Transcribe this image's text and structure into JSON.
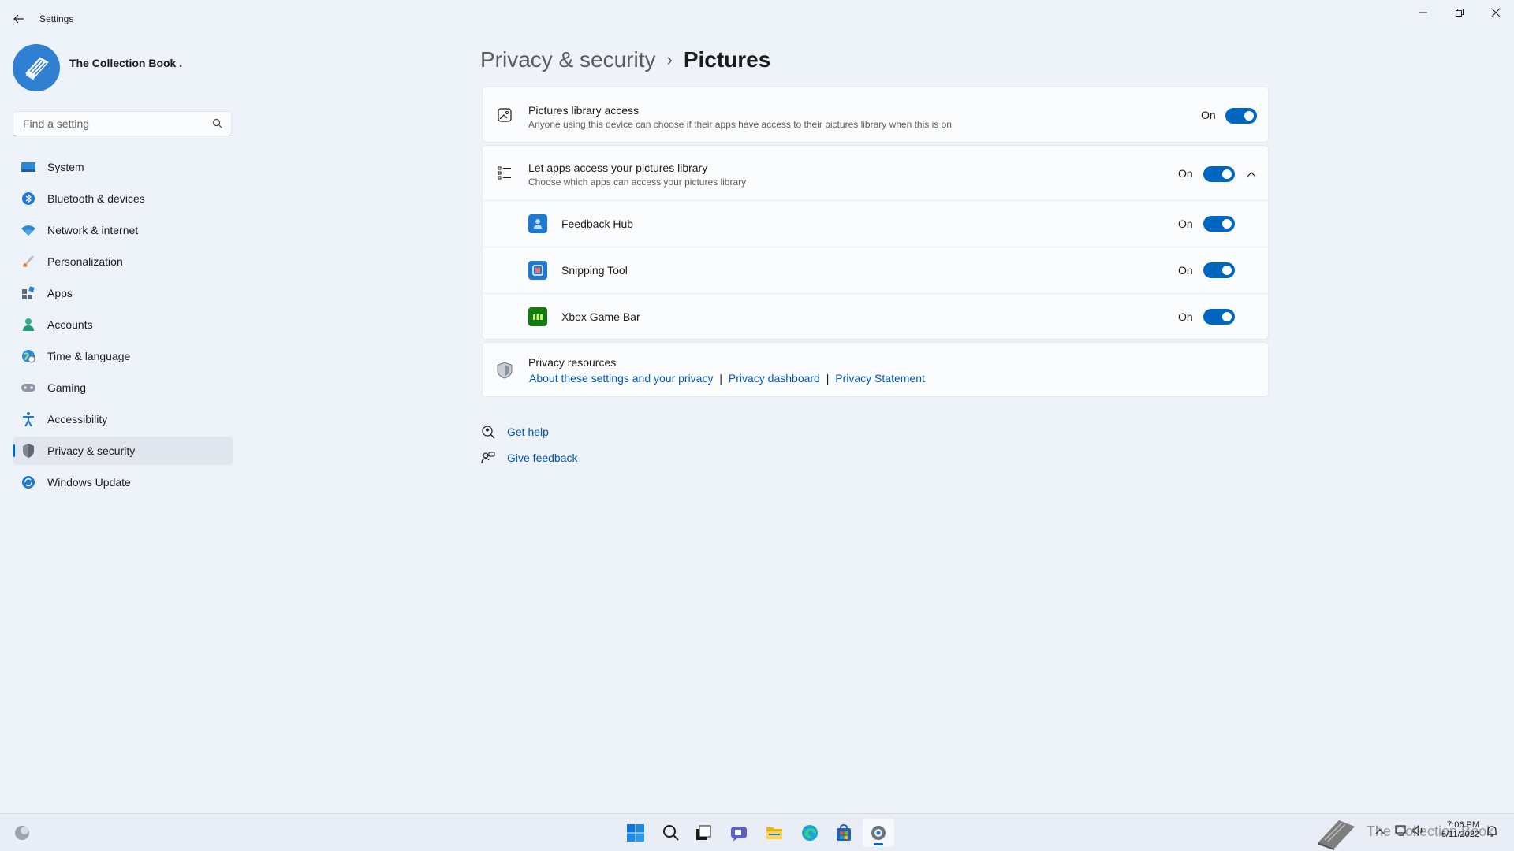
{
  "window": {
    "title": "Settings"
  },
  "profile": {
    "name": "The Collection Book ."
  },
  "search": {
    "placeholder": "Find a setting"
  },
  "sidebar": {
    "items": [
      {
        "label": "System",
        "icon": "system-icon"
      },
      {
        "label": "Bluetooth & devices",
        "icon": "bluetooth-icon"
      },
      {
        "label": "Network & internet",
        "icon": "wifi-icon"
      },
      {
        "label": "Personalization",
        "icon": "brush-icon"
      },
      {
        "label": "Apps",
        "icon": "apps-icon"
      },
      {
        "label": "Accounts",
        "icon": "person-icon"
      },
      {
        "label": "Time & language",
        "icon": "globe-clock-icon"
      },
      {
        "label": "Gaming",
        "icon": "gamepad-icon"
      },
      {
        "label": "Accessibility",
        "icon": "accessibility-icon"
      },
      {
        "label": "Privacy & security",
        "icon": "shield-icon",
        "selected": true
      },
      {
        "label": "Windows Update",
        "icon": "update-icon"
      }
    ]
  },
  "breadcrumb": {
    "parent": "Privacy & security",
    "separator": "›",
    "current": "Pictures"
  },
  "pictures_access": {
    "title": "Pictures library access",
    "description": "Anyone using this device can choose if their apps have access to their pictures library when this is on",
    "state": "On",
    "enabled": true
  },
  "apps_access": {
    "title": "Let apps access your pictures library",
    "description": "Choose which apps can access your pictures library",
    "state": "On",
    "enabled": true,
    "expanded": true,
    "apps": [
      {
        "name": "Feedback Hub",
        "state": "On",
        "enabled": true,
        "icon": "feedback-hub-icon"
      },
      {
        "name": "Snipping Tool",
        "state": "On",
        "enabled": true,
        "icon": "snipping-tool-icon"
      },
      {
        "name": "Xbox Game Bar",
        "state": "On",
        "enabled": true,
        "icon": "xbox-game-bar-icon"
      }
    ]
  },
  "privacy_resources": {
    "title": "Privacy resources",
    "links": [
      "About these settings and your privacy",
      "Privacy dashboard",
      "Privacy Statement"
    ],
    "separator": "|"
  },
  "help": {
    "get_help": "Get help",
    "give_feedback": "Give feedback"
  },
  "taskbar": {
    "apps": [
      "start-icon",
      "search-icon",
      "task-view-icon",
      "chat-icon",
      "file-explorer-icon",
      "edge-icon",
      "store-icon",
      "settings-icon"
    ],
    "active": "settings-icon",
    "time": "7:06 PM",
    "date": "6/11/2022",
    "watermark": "The Collection Book"
  },
  "colors": {
    "accent": "#0067c0",
    "background": "#eef3fa",
    "card": "#fbfcfe",
    "link": "#0059b3"
  }
}
